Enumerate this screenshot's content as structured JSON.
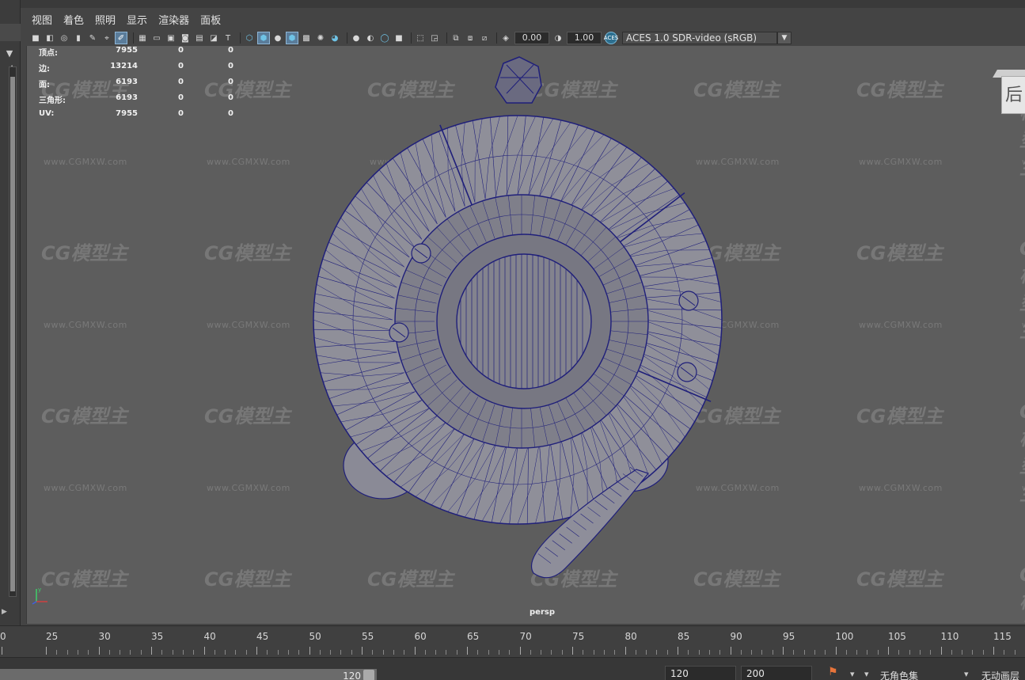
{
  "menubar": {
    "items": [
      "视图",
      "着色",
      "照明",
      "显示",
      "渲染器",
      "面板"
    ]
  },
  "toolbar": {
    "exposure_value": "0.00",
    "gamma_value": "1.00",
    "aces_icon": "ACES",
    "colorspace": "ACES 1.0 SDR-video (sRGB)"
  },
  "hud": {
    "rows": [
      {
        "label": "顶点:",
        "v1": "7955",
        "v2": "0",
        "v3": "0"
      },
      {
        "label": "边:",
        "v1": "13214",
        "v2": "0",
        "v3": "0"
      },
      {
        "label": "面:",
        "v1": "6193",
        "v2": "0",
        "v3": "0"
      },
      {
        "label": "三角形:",
        "v1": "6193",
        "v2": "0",
        "v3": "0"
      },
      {
        "label": "UV:",
        "v1": "7955",
        "v2": "0",
        "v3": "0"
      }
    ]
  },
  "viewport": {
    "camera_label": "persp",
    "viewcube_face": "后",
    "axis_label": "y"
  },
  "watermark": {
    "logo_text": "CG模型主",
    "url_text": "www.CGMXW.com"
  },
  "timeline": {
    "ticks": [
      "0",
      "25",
      "30",
      "35",
      "40",
      "45",
      "50",
      "55",
      "60",
      "65",
      "70",
      "75",
      "80",
      "85",
      "90",
      "95",
      "100",
      "105",
      "110",
      "115"
    ]
  },
  "rangebar": {
    "range_end_value": "120",
    "start_field": "120",
    "end_field": "200",
    "character_set": "无角色集",
    "anim_layer": "无动画层"
  },
  "colors": {
    "wireframe": "#1f1f7a",
    "surface": "#8f8f99",
    "viewport_bg": "#5d5d5d",
    "key_icon": "#e8743a"
  }
}
